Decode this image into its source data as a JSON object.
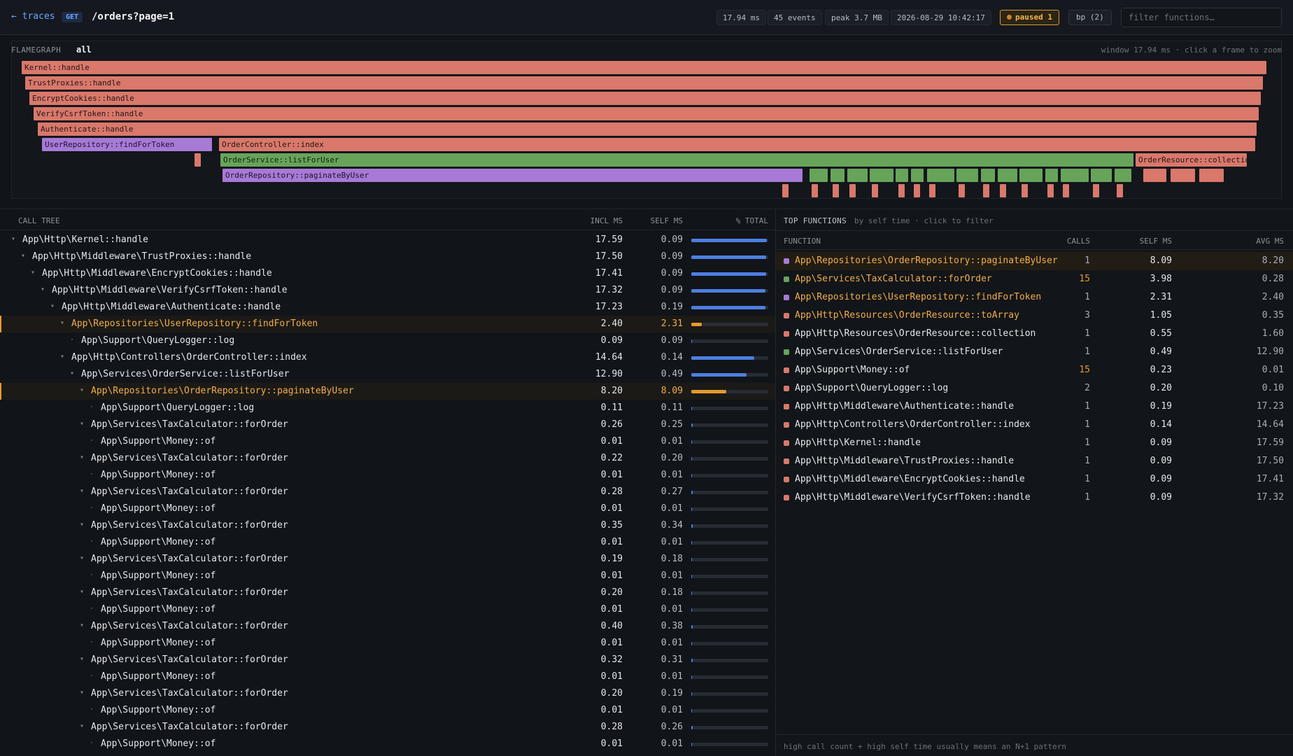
{
  "header": {
    "back": "← traces",
    "method": "GET",
    "path": "/orders?page=1",
    "duration": "17.94 ms",
    "events": "45 events",
    "peak": "peak 3.7 MB",
    "timestamp": "2026-08-29 10:42:17",
    "paused": "paused 1",
    "bp": "bp (2)",
    "filter_placeholder": "filter functions…"
  },
  "colors": {
    "controller": "#d9786b",
    "service": "#67a45a",
    "repository": "#a77ad6",
    "accent": "#e59a2f",
    "bar": "#4d7fe0"
  },
  "flamegraph": {
    "label": "FLAMEGRAPH",
    "tab": "all",
    "hint": "window 17.94 ms · click a frame to zoom",
    "frames": [
      {
        "label": "Kernel::handle",
        "kind": "red"
      },
      {
        "label": "TrustProxies::handle",
        "kind": "red"
      },
      {
        "label": "EncryptCookies::handle",
        "kind": "red"
      },
      {
        "label": "VerifyCsrfToken::handle",
        "kind": "red"
      },
      {
        "label": "Authenticate::handle",
        "kind": "red"
      },
      {
        "label": "UserRepository::findForToken",
        "kind": "purple"
      },
      {
        "label": "OrderController::index",
        "kind": "red"
      },
      {
        "label": "OrderService::listForUser",
        "kind": "green"
      },
      {
        "label": "OrderResource::collection",
        "kind": "red"
      },
      {
        "label": "OrderRepository::paginateByUser",
        "kind": "purple"
      }
    ]
  },
  "calltree": {
    "title": "CALL TREE",
    "col_incl": "INCL MS",
    "col_self": "SELF MS",
    "col_pct": "% TOTAL",
    "rows": [
      {
        "name": "App\\Http\\Kernel::handle",
        "incl": "17.59",
        "self": "0.09",
        "pct": 0.981
      },
      {
        "name": "App\\Http\\Middleware\\TrustProxies::handle",
        "incl": "17.50",
        "self": "0.09",
        "pct": 0.975
      },
      {
        "name": "App\\Http\\Middleware\\EncryptCookies::handle",
        "incl": "17.41",
        "self": "0.09",
        "pct": 0.97
      },
      {
        "name": "App\\Http\\Middleware\\VerifyCsrfToken::handle",
        "incl": "17.32",
        "self": "0.09",
        "pct": 0.965
      },
      {
        "name": "App\\Http\\Middleware\\Authenticate::handle",
        "incl": "17.23",
        "self": "0.19",
        "pct": 0.96
      },
      {
        "name": "App\\Repositories\\UserRepository::findForToken",
        "incl": "2.40",
        "self": "2.31",
        "pct": 0.134
      },
      {
        "name": "App\\Support\\QueryLogger::log",
        "incl": "0.09",
        "self": "0.09",
        "pct": 0.005
      },
      {
        "name": "App\\Http\\Controllers\\OrderController::index",
        "incl": "14.64",
        "self": "0.14",
        "pct": 0.816
      },
      {
        "name": "App\\Services\\OrderService::listForUser",
        "incl": "12.90",
        "self": "0.49",
        "pct": 0.719
      },
      {
        "name": "App\\Repositories\\OrderRepository::paginateByUser",
        "incl": "8.20",
        "self": "8.09",
        "pct": 0.457
      },
      {
        "name": "App\\Support\\QueryLogger::log",
        "incl": "0.11",
        "self": "0.11",
        "pct": 0.006
      },
      {
        "name": "App\\Services\\TaxCalculator::forOrder",
        "incl": "0.26",
        "self": "0.25",
        "pct": 0.014
      },
      {
        "name": "App\\Support\\Money::of",
        "incl": "0.01",
        "self": "0.01",
        "pct": 0.001
      },
      {
        "name": "App\\Services\\TaxCalculator::forOrder",
        "incl": "0.22",
        "self": "0.20",
        "pct": 0.012
      },
      {
        "name": "App\\Support\\Money::of",
        "incl": "0.01",
        "self": "0.01",
        "pct": 0.001
      },
      {
        "name": "App\\Services\\TaxCalculator::forOrder",
        "incl": "0.28",
        "self": "0.27",
        "pct": 0.016
      },
      {
        "name": "App\\Support\\Money::of",
        "incl": "0.01",
        "self": "0.01",
        "pct": 0.001
      },
      {
        "name": "App\\Services\\TaxCalculator::forOrder",
        "incl": "0.35",
        "self": "0.34",
        "pct": 0.02
      },
      {
        "name": "App\\Support\\Money::of",
        "incl": "0.01",
        "self": "0.01",
        "pct": 0.001
      },
      {
        "name": "App\\Services\\TaxCalculator::forOrder",
        "incl": "0.19",
        "self": "0.18",
        "pct": 0.011
      },
      {
        "name": "App\\Support\\Money::of",
        "incl": "0.01",
        "self": "0.01",
        "pct": 0.001
      },
      {
        "name": "App\\Services\\TaxCalculator::forOrder",
        "incl": "0.20",
        "self": "0.18",
        "pct": 0.011
      },
      {
        "name": "App\\Support\\Money::of",
        "incl": "0.01",
        "self": "0.01",
        "pct": 0.001
      },
      {
        "name": "App\\Services\\TaxCalculator::forOrder",
        "incl": "0.40",
        "self": "0.38",
        "pct": 0.022
      },
      {
        "name": "App\\Support\\Money::of",
        "incl": "0.01",
        "self": "0.01",
        "pct": 0.001
      },
      {
        "name": "App\\Services\\TaxCalculator::forOrder",
        "incl": "0.32",
        "self": "0.31",
        "pct": 0.018
      },
      {
        "name": "App\\Support\\Money::of",
        "incl": "0.01",
        "self": "0.01",
        "pct": 0.001
      },
      {
        "name": "App\\Services\\TaxCalculator::forOrder",
        "incl": "0.20",
        "self": "0.19",
        "pct": 0.011
      },
      {
        "name": "App\\Support\\Money::of",
        "incl": "0.01",
        "self": "0.01",
        "pct": 0.001
      },
      {
        "name": "App\\Services\\TaxCalculator::forOrder",
        "incl": "0.28",
        "self": "0.26",
        "pct": 0.016
      },
      {
        "name": "App\\Support\\Money::of",
        "incl": "0.01",
        "self": "0.01",
        "pct": 0.001
      }
    ]
  },
  "topfunctions": {
    "title": "TOP FUNCTIONS",
    "subtitle": "by self time · click to filter",
    "col_function": "FUNCTION",
    "col_calls": "CALLS",
    "col_self": "SELF MS",
    "col_avg": "AVG MS",
    "rows": [
      {
        "name": "App\\Repositories\\OrderRepository::paginateByUser",
        "calls": "1",
        "self": "8.09",
        "avg": "8.20",
        "color": "#a77ad6"
      },
      {
        "name": "App\\Services\\TaxCalculator::forOrder",
        "calls": "15",
        "self": "3.98",
        "avg": "0.28",
        "color": "#67a45a"
      },
      {
        "name": "App\\Repositories\\UserRepository::findForToken",
        "calls": "1",
        "self": "2.31",
        "avg": "2.40",
        "color": "#a77ad6"
      },
      {
        "name": "App\\Http\\Resources\\OrderResource::toArray",
        "calls": "3",
        "self": "1.05",
        "avg": "0.35",
        "color": "#d9786b"
      },
      {
        "name": "App\\Http\\Resources\\OrderResource::collection",
        "calls": "1",
        "self": "0.55",
        "avg": "1.60",
        "color": "#d9786b"
      },
      {
        "name": "App\\Services\\OrderService::listForUser",
        "calls": "1",
        "self": "0.49",
        "avg": "12.90",
        "color": "#67a45a"
      },
      {
        "name": "App\\Support\\Money::of",
        "calls": "15",
        "self": "0.23",
        "avg": "0.01",
        "color": "#d9786b"
      },
      {
        "name": "App\\Support\\QueryLogger::log",
        "calls": "2",
        "self": "0.20",
        "avg": "0.10",
        "color": "#d9786b"
      },
      {
        "name": "App\\Http\\Middleware\\Authenticate::handle",
        "calls": "1",
        "self": "0.19",
        "avg": "17.23",
        "color": "#d9786b"
      },
      {
        "name": "App\\Http\\Controllers\\OrderController::index",
        "calls": "1",
        "self": "0.14",
        "avg": "14.64",
        "color": "#d9786b"
      },
      {
        "name": "App\\Http\\Kernel::handle",
        "calls": "1",
        "self": "0.09",
        "avg": "17.59",
        "color": "#d9786b"
      },
      {
        "name": "App\\Http\\Middleware\\TrustProxies::handle",
        "calls": "1",
        "self": "0.09",
        "avg": "17.50",
        "color": "#d9786b"
      },
      {
        "name": "App\\Http\\Middleware\\EncryptCookies::handle",
        "calls": "1",
        "self": "0.09",
        "avg": "17.41",
        "color": "#d9786b"
      },
      {
        "name": "App\\Http\\Middleware\\VerifyCsrfToken::handle",
        "calls": "1",
        "self": "0.09",
        "avg": "17.32",
        "color": "#d9786b"
      }
    ],
    "footer": "high call count + high self time usually means an N+1 pattern"
  }
}
